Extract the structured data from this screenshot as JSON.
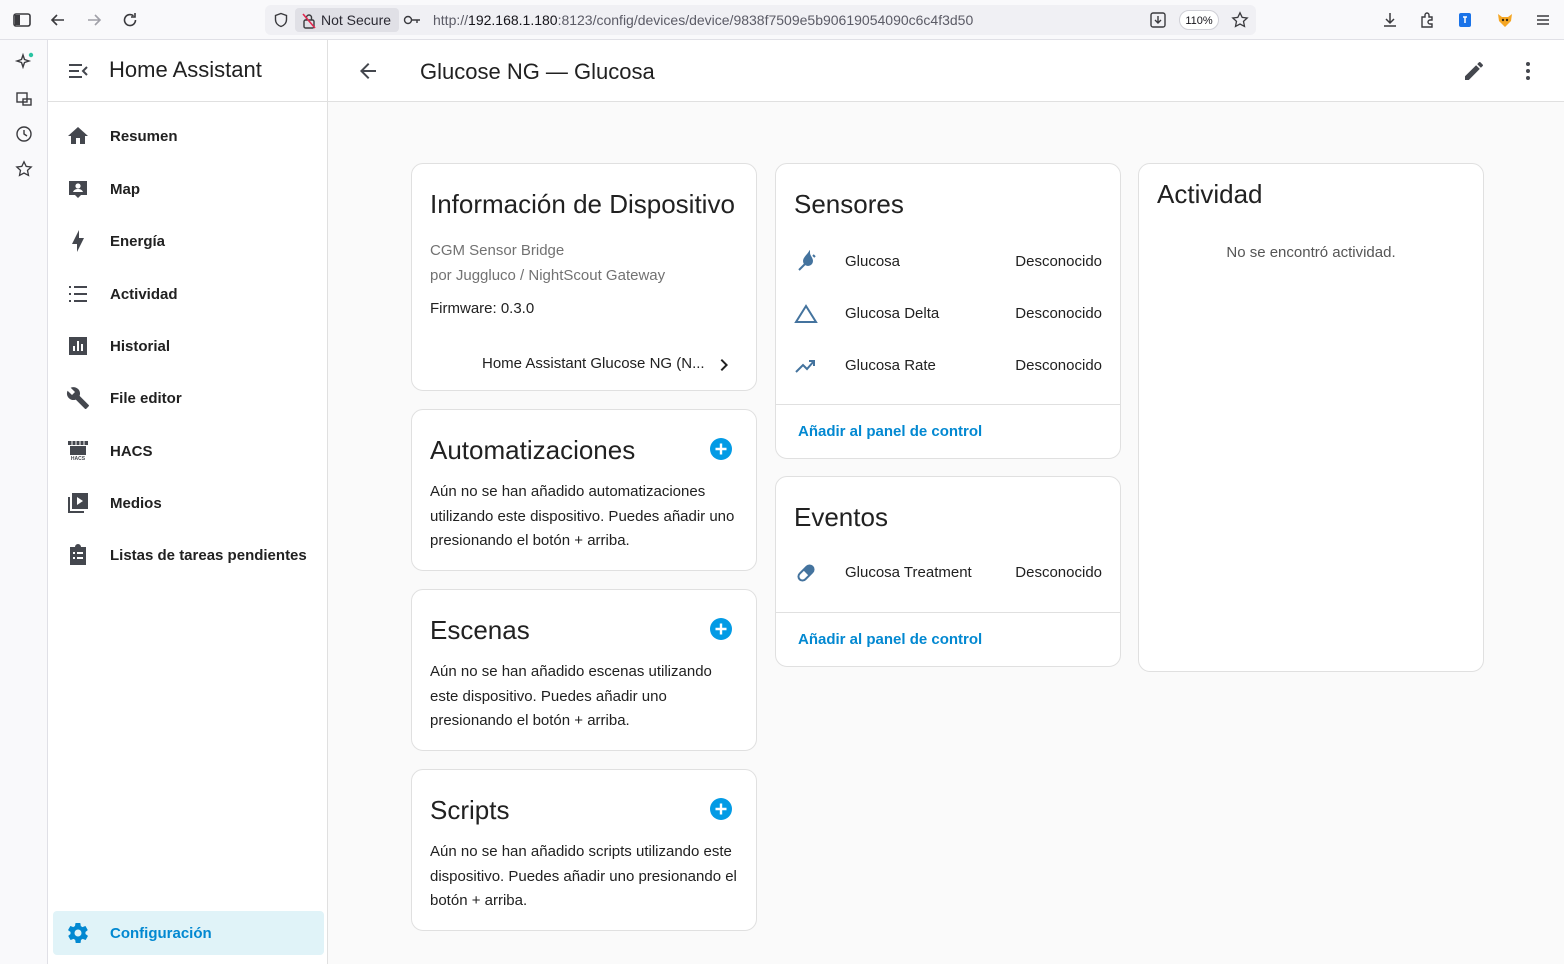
{
  "browser": {
    "not_secure_label": "Not Secure",
    "url_prefix": "http://",
    "url_host": "192.168.1.180",
    "url_path": ":8123/config/devices/device/9838f7509e5b90619054090c6c4f3d50",
    "zoom": "110%"
  },
  "sidebar": {
    "title": "Home Assistant",
    "items": [
      {
        "label": "Resumen"
      },
      {
        "label": "Map"
      },
      {
        "label": "Energía"
      },
      {
        "label": "Actividad"
      },
      {
        "label": "Historial"
      },
      {
        "label": "File editor"
      },
      {
        "label": "HACS"
      },
      {
        "label": "Medios"
      },
      {
        "label": "Listas de tareas pendientes"
      }
    ],
    "config_label": "Configuración",
    "hacs_icon_text": "HACS"
  },
  "header": {
    "title": "Glucose NG — Glucosa"
  },
  "device_info": {
    "title": "Información de Dispositivo",
    "model": "CGM Sensor Bridge",
    "manufacturer": "por Juggluco / NightScout Gateway",
    "firmware": "Firmware: 0.3.0",
    "integration_link": "Home Assistant Glucose NG (N..."
  },
  "automations": {
    "title": "Automatizaciones",
    "text": "Aún no se han añadido automatizaciones utilizando este dispositivo. Puedes añadir uno presionando el botón + arriba."
  },
  "scenes": {
    "title": "Escenas",
    "text": "Aún no se han añadido escenas utilizando este dispositivo. Puedes añadir uno presionando el botón + arriba."
  },
  "scripts": {
    "title": "Scripts",
    "text": "Aún no se han añadido scripts utilizando este dispositivo. Puedes añadir uno presionando el botón + arriba."
  },
  "sensors": {
    "title": "Sensores",
    "rows": [
      {
        "name": "Glucosa",
        "state": "Desconocido",
        "icon": "water-drop-icon"
      },
      {
        "name": "Glucosa Delta",
        "state": "Desconocido",
        "icon": "delta-icon"
      },
      {
        "name": "Glucosa Rate",
        "state": "Desconocido",
        "icon": "trending-up-icon"
      }
    ],
    "add_label": "Añadir al panel de control"
  },
  "events": {
    "title": "Eventos",
    "rows": [
      {
        "name": "Glucosa Treatment",
        "state": "Desconocido",
        "icon": "pill-icon"
      }
    ],
    "add_label": "Añadir al panel de control"
  },
  "activity": {
    "title": "Actividad",
    "empty_text": "No se encontró actividad."
  },
  "colors": {
    "accent": "#0288d1",
    "active_bg": "#e0f3f8",
    "entity_icon": "#44739e"
  }
}
